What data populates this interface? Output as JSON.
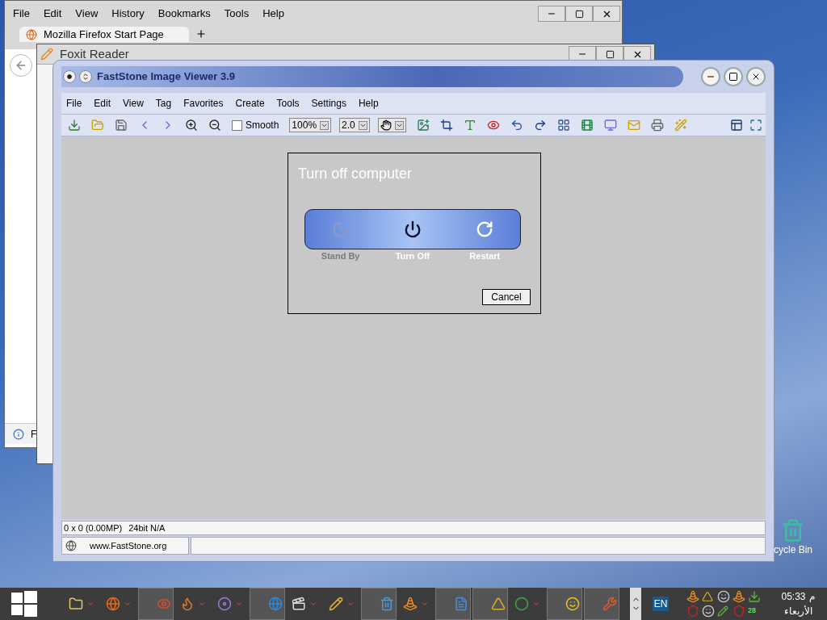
{
  "firefox": {
    "menu": [
      "File",
      "Edit",
      "View",
      "History",
      "Bookmarks",
      "Tools",
      "Help"
    ],
    "tab_title": "Mozilla Firefox Start Page",
    "infobar_text": "F"
  },
  "foxit": {
    "title": "Foxit Reader"
  },
  "faststone": {
    "title": "FastStone Image Viewer 3.9",
    "menu": [
      "File",
      "Edit",
      "View",
      "Tag",
      "Favorites",
      "Create",
      "Tools",
      "Settings",
      "Help"
    ],
    "toolbar": {
      "smooth": {
        "label": "Smooth",
        "checked": false
      },
      "zoom": "100%",
      "ratio": "2.0"
    },
    "status": {
      "dimensions": "0 x 0 (0.00MP)",
      "depth": "24bit N/A",
      "website": "www.FastStone.org"
    }
  },
  "dialog": {
    "title": "Turn off computer",
    "options": [
      {
        "kind": "standby",
        "label": "Stand By",
        "disabled": true
      },
      {
        "kind": "power",
        "label": "Turn Off",
        "disabled": false
      },
      {
        "kind": "restart",
        "label": "Restart",
        "disabled": false
      }
    ],
    "cancel": "Cancel"
  },
  "desktop_icon": {
    "label": "cycle Bin"
  },
  "taskbar": {
    "items": [
      {
        "kind": "folder",
        "open": false
      },
      {
        "kind": "firefox",
        "open": false
      },
      {
        "kind": "eye",
        "open": true
      },
      {
        "kind": "flame",
        "open": false
      },
      {
        "kind": "disc",
        "open": false
      },
      {
        "kind": "globe",
        "open": true
      },
      {
        "kind": "clapper",
        "open": false
      },
      {
        "kind": "pencil",
        "open": false
      },
      {
        "kind": "bin",
        "open": true
      },
      {
        "kind": "cone",
        "open": false
      },
      {
        "kind": "pen",
        "open": true
      },
      {
        "kind": "triangle",
        "open": true
      },
      {
        "kind": "chrome",
        "open": false
      },
      {
        "kind": "smile",
        "open": true
      },
      {
        "kind": "tool",
        "open": true
      }
    ],
    "language": "EN",
    "time": "05:33",
    "period": "م",
    "day": "الأربعاء",
    "tray_badge": "28"
  }
}
